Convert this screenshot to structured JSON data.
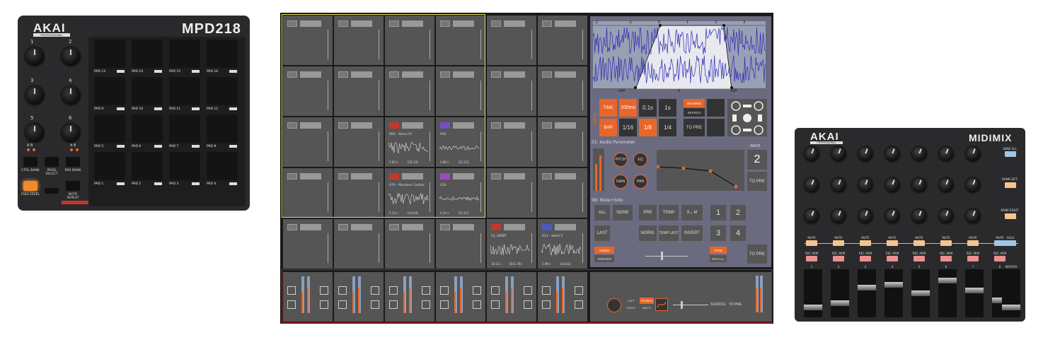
{
  "mpd218": {
    "brand": "AKAI",
    "brand_sub": "PROFESSIONAL",
    "model": "MPD218",
    "knobs": [
      "1",
      "2",
      "3",
      "4",
      "5",
      "6"
    ],
    "bank_ab": "A  B",
    "buttons": [
      "CTRL BANK",
      "PROG SELECT",
      "PAD BANK",
      "FULL LEVEL",
      "NOTE REPEAT"
    ],
    "pads": [
      "PAD 13",
      "PAD 14",
      "PAD 15",
      "PAD 16",
      "PAD 9",
      "PAD 10",
      "PAD 11",
      "PAD 12",
      "PAD 5",
      "PAD 6",
      "PAD 7",
      "PAD 8",
      "PAD 1",
      "PAD 2",
      "PAD 3",
      "PAD 4"
    ]
  },
  "grid": {
    "clips": [
      {
        "name": "064 - Ximo FX",
        "len": "2.63 s",
        "pos": "[24.33]"
      },
      {
        "name": "093",
        "len": "2.80 s",
        "pos": "[21.22]"
      },
      {
        "name": "070 - Machine Control",
        "len": "2.12 s",
        "pos": "[19.44]"
      },
      {
        "name": "010",
        "len": "4.32 s",
        "pos": "[21.67]"
      },
      {
        "name": "LS_300BT",
        "len": "10.51 s",
        "pos": "[611.76]"
      },
      {
        "name": "013 - Swell 5",
        "len": "1.99 s",
        "pos": "[16.62]"
      }
    ],
    "waveform_ticks_top": [
      "-2",
      "-1",
      "0",
      "1",
      "2",
      "3"
    ],
    "waveform_ticks_bottom": [
      "-100",
      "0",
      "100"
    ],
    "grid_label": "GRID",
    "time_buttons": [
      "TIME",
      "100ms",
      "0.1s",
      "1s"
    ],
    "bar_buttons": [
      "BAR",
      "1/16",
      "1/8",
      "1/4"
    ],
    "browse": "BROWSE",
    "search": "SEARCH",
    "to_pre": "TO PRE",
    "audio_param": "01: Audio Parameter",
    "wave_label": "WAVE",
    "wave_num": "2",
    "params": [
      "PITCH",
      "EQ",
      "GAIN",
      "PAN"
    ],
    "mute_solo": "06: Mute+Solo",
    "ms_buttons": [
      "ALL",
      "NONE",
      "PRE",
      "TEMP",
      "S↔M",
      "LAST",
      "NORM.",
      "TEMP LAST",
      "INVERT"
    ],
    "numbers": [
      "1",
      "2",
      "3",
      "4"
    ],
    "audio": "AUDIO",
    "trigger": "TRIGGER",
    "take": "TAKE",
    "recall": "RECALL",
    "bottom_left": "LEFT",
    "bottom_right": "RIGHT",
    "bottom_stereo": "STEREO",
    "bottom_multi": "MULTI",
    "source": "SOURCE",
    "mix_labels": [
      "PITCH",
      "EQ",
      "GAIN",
      "PAN"
    ]
  },
  "midimix": {
    "brand": "AKAI",
    "brand_sub": "PROFESSIONAL",
    "model": "MIDIMIX",
    "side_buttons": [
      "SEND ALL",
      "BANK LEFT",
      "BANK RIGHT"
    ],
    "mute": "MUTE",
    "solo": "SOLO",
    "rec_arm": "REC ARM",
    "channels": [
      "1",
      "2",
      "3",
      "4",
      "5",
      "6",
      "7",
      "8"
    ],
    "master": "MASTER"
  },
  "colors": {
    "accent": "#e8662a",
    "yellow_frame": "#e8e34a",
    "red_frame": "#b01a1a",
    "mute_color": "#f6c48f",
    "solo_color": "#9fc6e6",
    "rec_color": "#ec8f8f"
  }
}
